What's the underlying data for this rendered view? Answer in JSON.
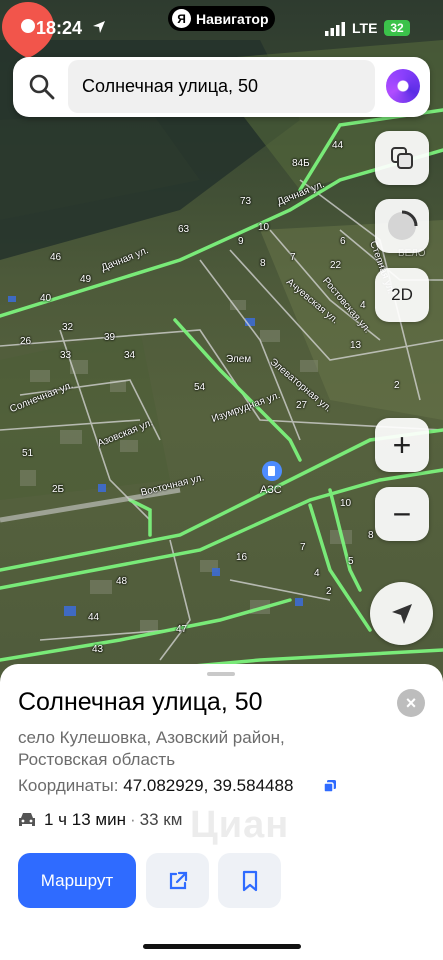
{
  "status_bar": {
    "time": "18:24",
    "app_pill": "Навигатор",
    "app_pill_logo": "Я",
    "network": "LTE",
    "battery": "32"
  },
  "search": {
    "value": "Солнечная улица, 50",
    "icon": "search-icon",
    "assistant_icon": "alice-icon"
  },
  "map": {
    "streets": [
      "Дачная ул.",
      "Дачная ул.",
      "Солнечная ул.",
      "Азовская ул.",
      "Восточная ул.",
      "Ростовская ул.",
      "Ачуевская ул.",
      "Элеваторная ул.",
      "Изумрудная ул.",
      "Степная ул."
    ],
    "poi": "АЗС",
    "poi_alt": "Элем",
    "house_numbers": [
      "44",
      "84Б",
      "73",
      "63",
      "46",
      "49",
      "40",
      "32",
      "39",
      "26",
      "33",
      "34",
      "54",
      "10",
      "9",
      "8",
      "7",
      "22",
      "13",
      "2",
      "4",
      "6",
      "27",
      "51",
      "2Б",
      "48",
      "44",
      "43",
      "47",
      "16",
      "10",
      "8",
      "7",
      "4",
      "2",
      "5"
    ],
    "faded_text": [
      "БЕЛО"
    ]
  },
  "controls": {
    "layers_icon": "layers-icon",
    "compass_icon": "compass-icon",
    "mode_label": "2D",
    "zoom_in": "+",
    "zoom_out": "−",
    "locate_icon": "locate-arrow-icon"
  },
  "place": {
    "title": "Солнечная улица, 50",
    "address": "село Кулешовка, Азовский район, Ростовская область",
    "coords_label": "Координаты:",
    "coords_value": "47.082929, 39.584488",
    "route_time": "1 ч 13 мин",
    "route_sep": "·",
    "route_dist": "33 км",
    "route_button": "Маршрут",
    "watermark": "Циан"
  },
  "colors": {
    "accent": "#2f6bff",
    "road": "#7cf27c",
    "pin": "#f2554b"
  }
}
